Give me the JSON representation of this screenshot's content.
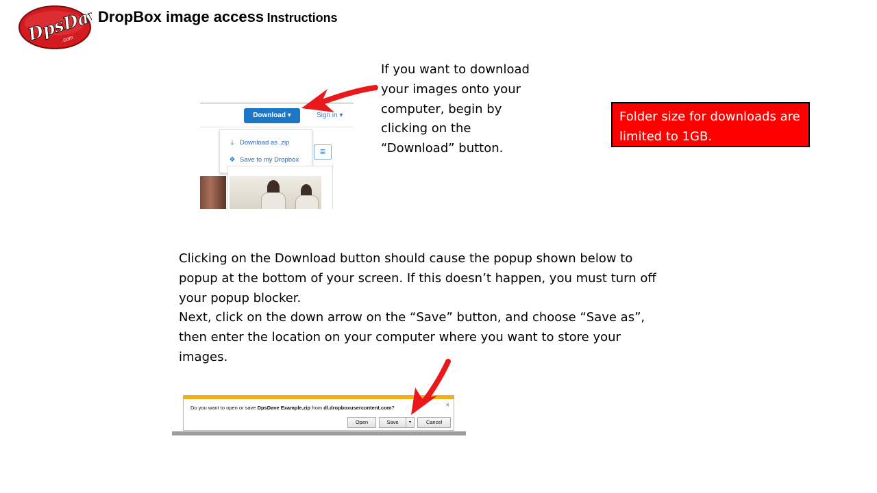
{
  "header": {
    "logo_text": "DpsDave",
    "logo_suffix": ".com",
    "title_main": "DropBox image access",
    "title_sub": "Instructions"
  },
  "top_screenshot": {
    "download_button": "Download ▾",
    "sign_in": "Sign in ▾",
    "menu": [
      {
        "label": "Download as .zip",
        "icon": "download-icon"
      },
      {
        "label": "Save to my Dropbox",
        "icon": "dropbox-icon"
      }
    ],
    "list_view_icon": "list-view-icon"
  },
  "instruction_1": "If you want to download your images onto your computer, begin by clicking on the “Download” button.",
  "note_box": {
    "text": "Folder size for downloads are limited to 1GB.",
    "color": "#ff0000"
  },
  "instruction_2": {
    "para1": "Clicking on the Download button should cause the popup shown below to popup at the bottom of your screen.  If this doesn’t happen, you must turn off your popup blocker.",
    "para2": "Next, click on the down arrow on the “Save” button, and choose “Save as”, then enter the location on your computer where you want to store your images."
  },
  "popup": {
    "msg_prefix": "Do you want to open or save ",
    "file_name": "DpsDave Example.zip",
    "msg_middle": " from ",
    "domain": "dl.dropboxusercontent.com",
    "msg_suffix": "?",
    "close": "×",
    "open_label": "Open",
    "save_label": "Save",
    "save_arrow": "▾",
    "cancel_label": "Cancel",
    "accent_color": "#f2ae1b"
  },
  "arrow_color": "#e8181b"
}
